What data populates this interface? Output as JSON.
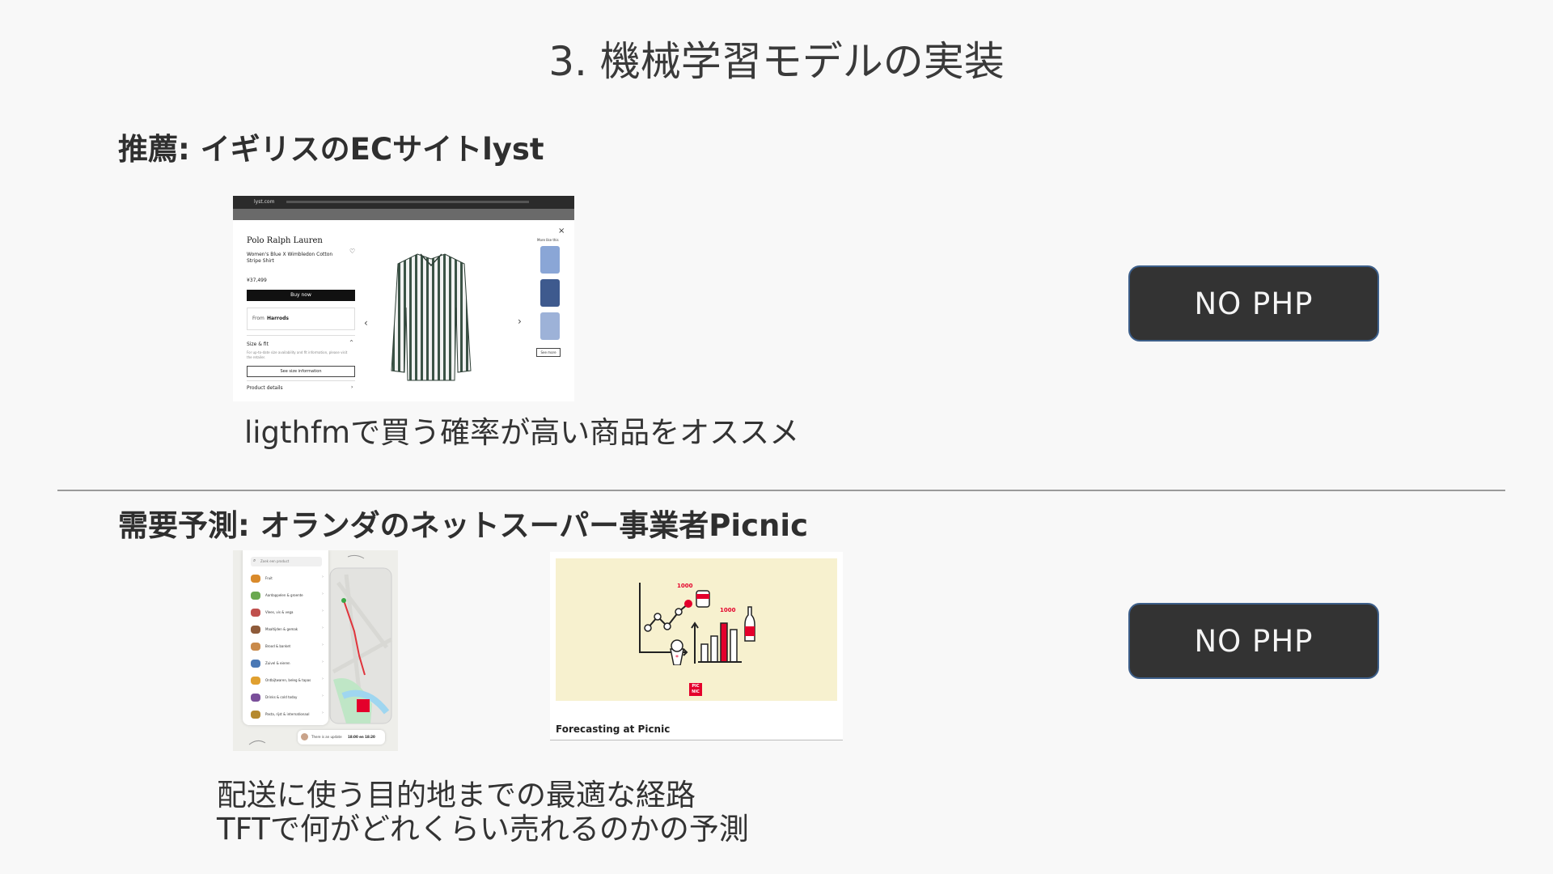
{
  "slide": {
    "title": "3. 機械学習モデルの実装"
  },
  "section1": {
    "heading": "推薦: イギリスのECサイトlyst",
    "caption": "ligthfmで買う確率が高い商品をオススメ",
    "button_label": "NO PHP",
    "screenshot": {
      "url": "lyst.com",
      "brand": "Polo Ralph Lauren",
      "product_line1": "Women's Blue X Wimbledon Cotton",
      "product_line2": "Stripe Shirt",
      "price": "¥37,499",
      "buy_label": "Buy now",
      "from_label": "From",
      "from_store": "Harrods",
      "size_fit": "Size & fit",
      "size_note_1": "For up-to-date size availability and fit information, please visit",
      "size_note_2": "the retailer.",
      "size_info_button": "See size information",
      "product_details": "Product details",
      "more_like_this": "More like this",
      "see_more": "See more"
    }
  },
  "section2": {
    "heading": "需要予測: オランダのネットスーパー事業者Picnic",
    "caption_line1": "配送に使う目的地までの最適な経路",
    "caption_line2": "TFTで何がどれくらい売れるのかの予測",
    "button_label": "NO PHP",
    "app_screenshot": {
      "search_placeholder": "Zoek een product",
      "categories": [
        "Fruit",
        "Aardappelen & groente",
        "Vlees, vis & vega",
        "Maaltijden & gemak",
        "Brood & banket",
        "Zuivel & eieren",
        "Ontbijtwaren, beleg & tapas",
        "Drinks & cold today",
        "Pasta, rijst & internationaal"
      ],
      "delivery_note": "There is an update",
      "delivery_time": "18:00 en 18:20"
    },
    "forecast_card": {
      "caption": "Forecasting at Picnic",
      "label_1": "1000",
      "label_2": "1000",
      "logo_line1": "PIC",
      "logo_line2": "NIC"
    }
  }
}
